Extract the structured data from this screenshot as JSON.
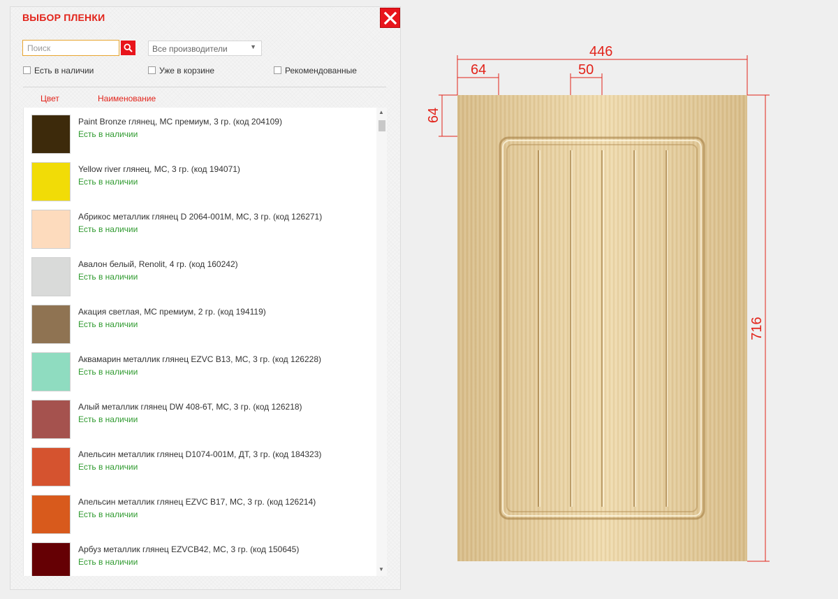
{
  "dialog": {
    "title": "ВЫБОР ПЛЕНКИ",
    "close_icon": "close-icon"
  },
  "search": {
    "placeholder": "Поиск",
    "value": "",
    "button_icon": "search-icon"
  },
  "manufacturer_select": {
    "selected": "Все производители",
    "arrow": "▼"
  },
  "filters": [
    {
      "label": "Есть в наличии",
      "checked": false
    },
    {
      "label": "Уже в корзине",
      "checked": false
    },
    {
      "label": "Рекомендованные",
      "checked": false
    }
  ],
  "columns": {
    "color": "Цвет",
    "name": "Наименование"
  },
  "items": [
    {
      "name": "Paint Bronze глянец, МС премиум, 3 гр. (код 204109)",
      "stock": "Есть в наличии",
      "color": "#3d2a0b"
    },
    {
      "name": "Yellow river глянец, МС, 3 гр. (код 194071)",
      "stock": "Есть в наличии",
      "color": "#f1dc07"
    },
    {
      "name": "Абрикос металлик глянец D 2064-001М, МС, 3 гр. (код 126271)",
      "stock": "Есть в наличии",
      "color": "#fddbbd"
    },
    {
      "name": "Авалон белый, Renolit, 4 гр. (код 160242)",
      "stock": "Есть в наличии",
      "color": "#d9dad9"
    },
    {
      "name": "Акация светлая, МС премиум, 2 гр. (код 194119)",
      "stock": "Есть в наличии",
      "color": "#8f7352"
    },
    {
      "name": "Аквамарин металлик глянец EZVC B13, МС, 3 гр. (код 126228)",
      "stock": "Есть в наличии",
      "color": "#8fdcc0"
    },
    {
      "name": "Алый металлик глянец DW 408-6T, МС, 3 гр. (код 126218)",
      "stock": "Есть в наличии",
      "color": "#a5524e"
    },
    {
      "name": "Апельсин металлик глянец D1074-001M, ДТ, 3 гр. (код 184323)",
      "stock": "Есть в наличии",
      "color": "#d5532f"
    },
    {
      "name": "Апельсин металлик глянец EZVC B17, МС, 3 гр. (код 126214)",
      "stock": "Есть в наличии",
      "color": "#d85a1c"
    },
    {
      "name": "Арбуз металлик глянец EZVCB42, МС, 3 гр. (код 150645)",
      "stock": "Есть в наличии",
      "color": "#650004"
    }
  ],
  "scrollbar": {
    "up": "▲",
    "down": "▼"
  },
  "door": {
    "dimensions": {
      "width": "446",
      "height": "716",
      "frame_left": "64",
      "frame_top": "64",
      "groove_spacing": "50"
    },
    "colors": {
      "dimension_lines": "#e2231a",
      "wood_light": "#f0dcb0",
      "wood_dark": "#d8bd8a"
    }
  }
}
